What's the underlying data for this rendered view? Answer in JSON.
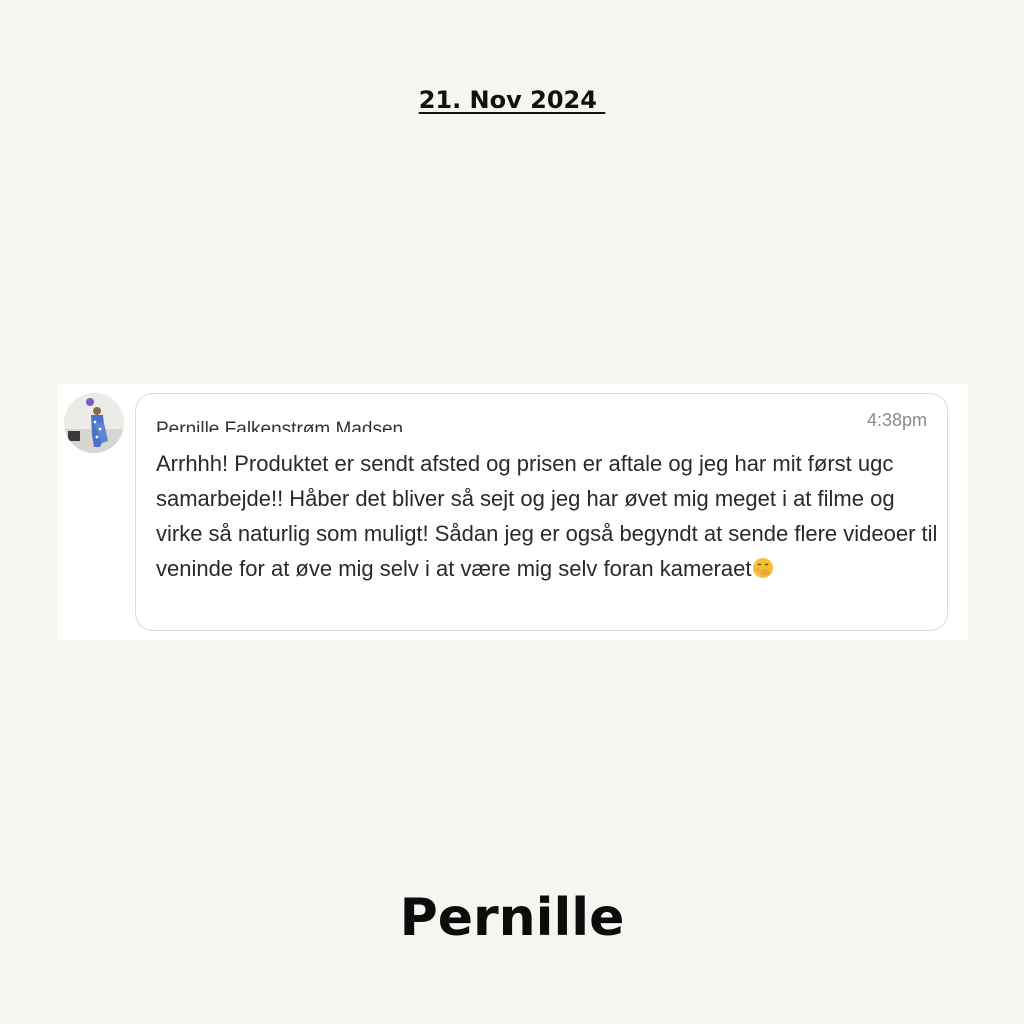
{
  "header": {
    "date": "21. Nov 2024 "
  },
  "message": {
    "sender": "Pernille Falkenstrøm Madsen",
    "time": "4:38pm",
    "text": "Arrhhh! Produktet er sendt afsted og prisen er aftale og jeg har mit først ugc samarbejde!! Håber det bliver så sejt og jeg har øvet mig meget i at filme og virke så naturlig som muligt! Sådan jeg er også begyndt at sende flere videoer til veninde for at øve mig selv i at være mig selv foran kameraet",
    "emoji": "face-with-hand-over-mouth-emoji"
  },
  "footer": {
    "name": "Pernille"
  }
}
